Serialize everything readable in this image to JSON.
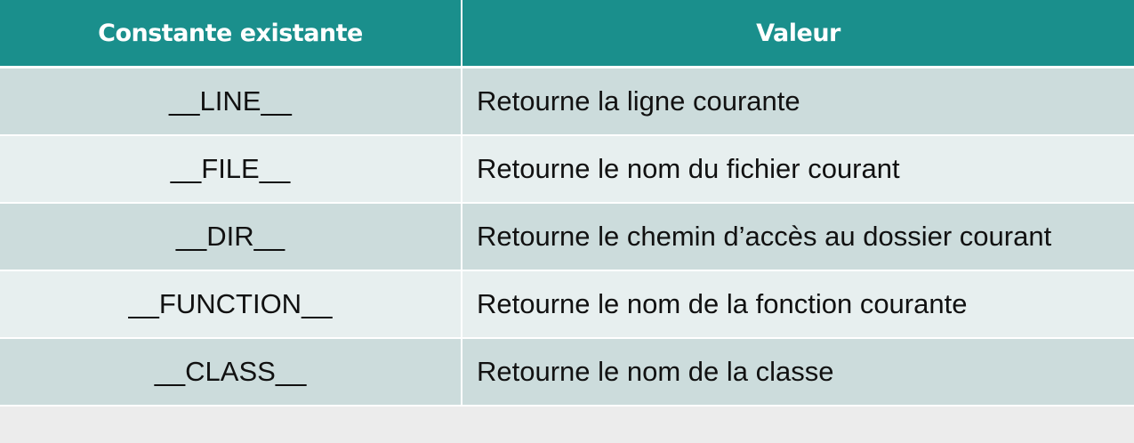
{
  "table": {
    "headers": {
      "constant": "Constante existante",
      "value": "Valeur"
    },
    "rows": [
      {
        "constant": "__LINE__",
        "value": "Retourne la ligne courante"
      },
      {
        "constant": "__FILE__",
        "value": "Retourne le nom du fichier courant"
      },
      {
        "constant": "__DIR__",
        "value": "Retourne le chemin d’accès au dossier courant"
      },
      {
        "constant": "__FUNCTION__",
        "value": "Retourne le nom de la fonction courante"
      },
      {
        "constant": "__CLASS__",
        "value": "Retourne le nom de la classe"
      }
    ]
  },
  "colors": {
    "header_bg": "#1a8f8c",
    "row_dark": "#ccdcdc",
    "row_light": "#e7efef",
    "page_bg": "#ececec"
  }
}
